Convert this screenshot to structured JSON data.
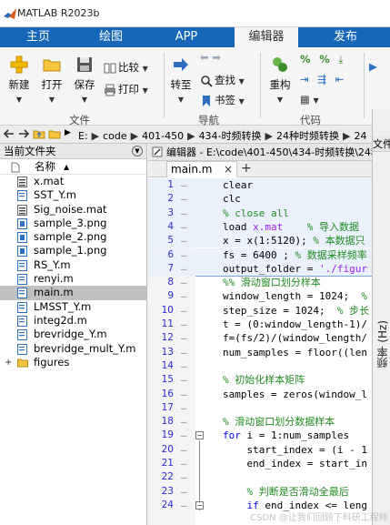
{
  "window": {
    "title": "MATLAB R2023b"
  },
  "ribbon_tabs": [
    "主页",
    "绘图",
    "APP",
    "编辑器",
    "发布"
  ],
  "ribbon": {
    "new_label": "新建",
    "open_label": "打开",
    "save_label": "保存",
    "compare_label": "比较",
    "print_label": "打印",
    "file_group": "文件",
    "goto_label": "转至",
    "find_label": "查找",
    "bookmark_label": "书签",
    "nav_group": "导航",
    "refactor_label": "重构",
    "code_group": "代码"
  },
  "address": {
    "segments": [
      "E:",
      "code",
      "401-450",
      "434-时频转换",
      "24种时频转换",
      "24"
    ]
  },
  "file_panel": {
    "title": "当前文件夹",
    "column_header": "名称",
    "files": [
      {
        "name": "x.mat",
        "icon": "mat-file-icon"
      },
      {
        "name": "SST_Y.m",
        "icon": "script-file-icon"
      },
      {
        "name": "Sig_noise.mat",
        "icon": "mat-file-icon"
      },
      {
        "name": "sample_3.png",
        "icon": "image-file-icon"
      },
      {
        "name": "sample_2.png",
        "icon": "image-file-icon"
      },
      {
        "name": "sample_1.png",
        "icon": "image-file-icon"
      },
      {
        "name": "RS_Y.m",
        "icon": "script-file-icon"
      },
      {
        "name": "renyi.m",
        "icon": "script-file-icon"
      },
      {
        "name": "main.m",
        "icon": "script-file-icon",
        "selected": true
      },
      {
        "name": "LMSST_Y.m",
        "icon": "script-file-icon"
      },
      {
        "name": "integ2d.m",
        "icon": "script-file-icon"
      },
      {
        "name": "brevridge_Y.m",
        "icon": "script-file-icon"
      },
      {
        "name": "brevridge_mult_Y.m",
        "icon": "script-file-icon"
      },
      {
        "name": "figures",
        "icon": "folder-icon",
        "expandable": true
      }
    ]
  },
  "editor": {
    "header": "编辑器 - E:\\code\\401-450\\434-时频转换\\24种时频转换\\24",
    "tab_label": "main.m",
    "tab_close": "×",
    "tab_add": "+",
    "lines": [
      {
        "n": "1",
        "segs": [
          [
            "",
            "clear"
          ]
        ]
      },
      {
        "n": "2",
        "segs": [
          [
            "",
            "clc"
          ]
        ]
      },
      {
        "n": "3",
        "segs": [
          [
            "cm",
            "% close all"
          ]
        ]
      },
      {
        "n": "4",
        "segs": [
          [
            "",
            "load "
          ],
          [
            "st",
            "x.mat"
          ],
          [
            "",
            "    "
          ],
          [
            "cm",
            "% 导入数据"
          ]
        ]
      },
      {
        "n": "5",
        "segs": [
          [
            "",
            "x = x(1:5120); "
          ],
          [
            "cm",
            "% 本数据只"
          ]
        ]
      },
      {
        "n": "6",
        "segs": [
          [
            "",
            "fs = 6400 ; "
          ],
          [
            "cm",
            "% 数据采样频率"
          ]
        ]
      },
      {
        "n": "7",
        "segs": [
          [
            "",
            "output_folder = "
          ],
          [
            "st",
            "'./figur"
          ]
        ]
      },
      {
        "n": "8",
        "segs": [
          [
            "cm",
            "%% 滑动窗口划分样本"
          ]
        ]
      },
      {
        "n": "9",
        "segs": [
          [
            "",
            "window_length = 1024;  "
          ],
          [
            "cm",
            "%"
          ]
        ]
      },
      {
        "n": "10",
        "segs": [
          [
            "",
            "step_size = 1024;  "
          ],
          [
            "cm",
            "% 步长"
          ]
        ]
      },
      {
        "n": "11",
        "segs": [
          [
            "",
            "t = (0:window_length-1)/"
          ]
        ]
      },
      {
        "n": "12",
        "segs": [
          [
            "",
            "f=(fs/2)/(window_length/"
          ]
        ]
      },
      {
        "n": "13",
        "segs": [
          [
            "",
            "num_samples = floor((len"
          ]
        ]
      },
      {
        "n": "14",
        "segs": [
          [
            "",
            ""
          ]
        ]
      },
      {
        "n": "15",
        "segs": [
          [
            "cm",
            "% 初始化样本矩阵"
          ]
        ]
      },
      {
        "n": "16",
        "segs": [
          [
            "",
            "samples = zeros(window_l"
          ]
        ]
      },
      {
        "n": "17",
        "segs": [
          [
            "",
            ""
          ]
        ]
      },
      {
        "n": "18",
        "segs": [
          [
            "cm",
            "% 滑动窗口划分数据样本"
          ]
        ]
      },
      {
        "n": "19",
        "segs": [
          [
            "kw",
            "for"
          ],
          [
            "",
            " i = 1:num_samples"
          ]
        ]
      },
      {
        "n": "20",
        "segs": [
          [
            "",
            "    start_index = (i - 1"
          ]
        ]
      },
      {
        "n": "21",
        "segs": [
          [
            "",
            "    end_index = start_in"
          ]
        ]
      },
      {
        "n": "22",
        "segs": [
          [
            "",
            ""
          ]
        ]
      },
      {
        "n": "23",
        "segs": [
          [
            "cm",
            "    % 判断是否滑动全最后"
          ]
        ]
      },
      {
        "n": "24",
        "segs": [
          [
            "kw",
            "    if"
          ],
          [
            "",
            " end_index <= leng"
          ]
        ]
      }
    ]
  },
  "right_panel": {
    "label": "文件",
    "vertical_label": "频率 (Hz)"
  },
  "watermark": "CSDN @让我们回顾下科研工程师",
  "colors": {
    "ribbon_blue": "#1667b7",
    "comment": "#228b22",
    "keyword": "#0000ff",
    "string": "#a020f0",
    "line_number": "#2b2bd6",
    "selected_row": "#c0c0c0"
  }
}
